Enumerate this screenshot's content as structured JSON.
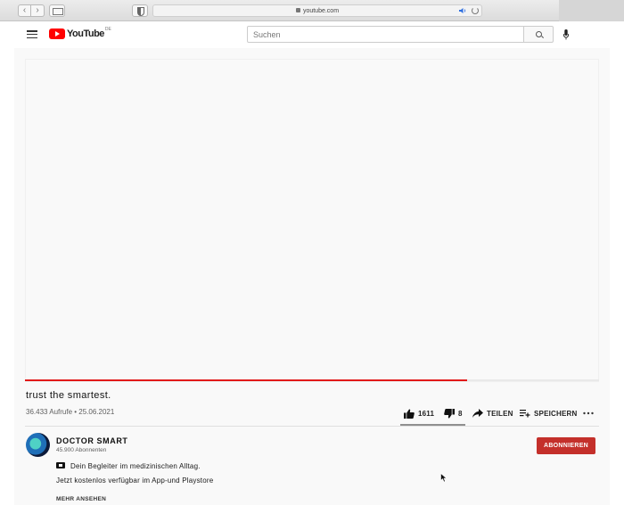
{
  "browser": {
    "url": "youtube.com"
  },
  "header": {
    "logo_text": "YouTube",
    "country_code": "DE",
    "search_placeholder": "Suchen"
  },
  "video": {
    "progress": 0.77,
    "progress_color": "#e21a1a",
    "title": "trust the smartest.",
    "meta": "36.433 Aufrufe • 25.06.2021",
    "actions": {
      "likes": "1611",
      "dislikes": "8",
      "share_label": "TEILEN",
      "save_label": "SPEICHERN"
    }
  },
  "channel": {
    "name": "DOCTOR SMART",
    "subscribers": "45.900 Abonnenten",
    "subscribe_label": "ABONNIEREN",
    "subscribe_color": "#c4302b"
  },
  "description": {
    "line1": "Dein Begleiter im medizinischen Alltag.",
    "line2": "Jetzt kostenlos verfügbar im App-und Playstore",
    "show_more": "MEHR ANSEHEN"
  }
}
